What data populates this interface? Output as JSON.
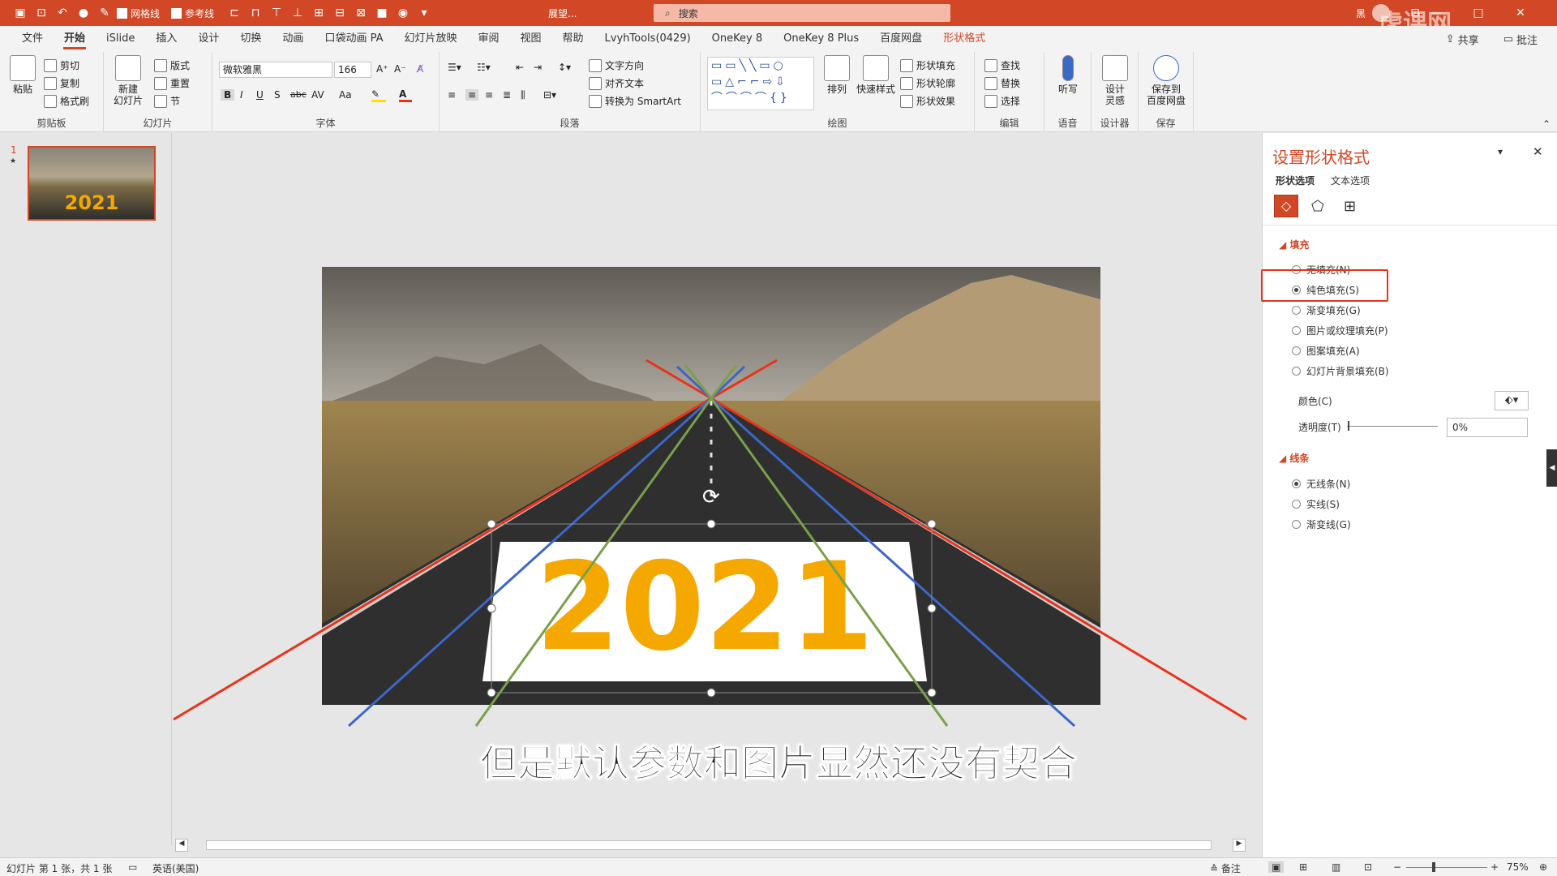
{
  "titlebar": {
    "gridlines_label": "网格线",
    "guides_label": "参考线",
    "doc_title": "展望...",
    "search_placeholder": "搜索",
    "user_initial": "黑",
    "share_label": "共享",
    "comment_label": "批注",
    "watermark": "虎课网"
  },
  "tabs": [
    "文件",
    "开始",
    "iSlide",
    "插入",
    "设计",
    "切换",
    "动画",
    "口袋动画 PA",
    "幻灯片放映",
    "审阅",
    "视图",
    "帮助",
    "LvyhTools(0429)",
    "OneKey 8",
    "OneKey 8 Plus",
    "百度网盘",
    "形状格式"
  ],
  "active_tab": "开始",
  "context_tab": "形状格式",
  "ribbon": {
    "clipboard": {
      "label": "剪贴板",
      "paste": "粘贴",
      "cut": "剪切",
      "copy": "复制",
      "format_painter": "格式刷"
    },
    "slides": {
      "label": "幻灯片",
      "new_slide": "新建\n幻灯片",
      "layout": "版式",
      "reset": "重置",
      "section": "节"
    },
    "font": {
      "label": "字体",
      "font_name": "微软雅黑",
      "font_size": "166",
      "bold": "B",
      "italic": "I",
      "underline": "U",
      "shadow": "S",
      "strike": "abc",
      "spacing": "AV",
      "case": "Aa"
    },
    "paragraph": {
      "label": "段落",
      "text_direction": "文字方向",
      "align_text": "对齐文本",
      "smartart": "转换为 SmartArt"
    },
    "drawing": {
      "label": "绘图",
      "arrange": "排列",
      "quick_styles": "快速样式",
      "shape_fill": "形状填充",
      "shape_outline": "形状轮廓",
      "shape_effects": "形状效果"
    },
    "editing": {
      "label": "编辑",
      "find": "查找",
      "replace": "替换",
      "select": "选择"
    },
    "voice": {
      "label": "语音",
      "dictate": "听写"
    },
    "designer": {
      "label": "设计器",
      "design_ideas": "设计\n灵感"
    },
    "save": {
      "label": "保存",
      "save_baidu": "保存到\n百度网盘"
    }
  },
  "thumbnail": {
    "number": "1",
    "star": "★",
    "year": "2021"
  },
  "slide": {
    "year": "2021"
  },
  "subtitle": "但是默认参数和图片显然还没有契合",
  "pane": {
    "title": "设置形状格式",
    "tab_shape": "形状选项",
    "tab_text": "文本选项",
    "fill_section": "填充",
    "fill_options": [
      "无填充(N)",
      "纯色填充(S)",
      "渐变填充(G)",
      "图片或纹理填充(P)",
      "图案填充(A)",
      "幻灯片背景填充(B)"
    ],
    "fill_selected": 1,
    "color_label": "颜色(C)",
    "transparency_label": "透明度(T)",
    "transparency_value": "0%",
    "line_section": "线条",
    "line_options": [
      "无线条(N)",
      "实线(S)",
      "渐变线(G)"
    ],
    "line_selected": 0
  },
  "status": {
    "slide_info": "幻灯片 第 1 张，共 1 张",
    "language": "英语(美国)",
    "notes": "备注",
    "zoom": "75%"
  },
  "colors": {
    "accent": "#d24726",
    "year": "#f5a800",
    "red_line": "#e8331c",
    "blue_line": "#3b67c7",
    "green_line": "#7aa04a"
  }
}
